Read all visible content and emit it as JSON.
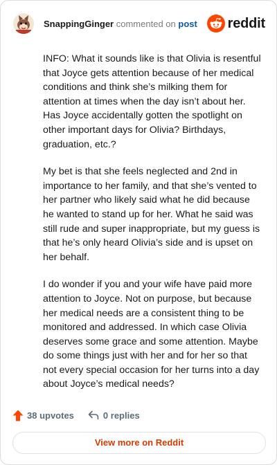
{
  "comment": {
    "author": "SnappingGinger",
    "verb": "commented on",
    "target": "post",
    "paragraphs": [
      "INFO: What it sounds like is that Olivia is resentful that Joyce gets attention because of her medical conditions and think she’s milking them for attention at times when the day isn’t about her. Has Joyce accidentally gotten the spotlight on other important days for Olivia? Birthdays, graduation, etc.?",
      "My bet is that she feels neglected and 2nd in importance to her family, and that she’s vented to her partner who likely said what he did because he wanted to stand up for her. What he said was still rude and super inappropriate, but my guess is that he’s only heard Olivia’s side and is upset on her behalf.",
      "I do wonder if you and your wife have paid more attention to Joyce. Not on purpose, but because her medical needs are a consistent thing to be monitored and addressed. In which case Olivia deserves some grace and some attention. Maybe do some things just with her and for her so that not every special occasion for her turns into a day about Joyce’s medical needs?"
    ]
  },
  "brand": {
    "wordmark": "reddit",
    "logo_icon": "reddit-snoo-icon",
    "color": "#ff4500"
  },
  "footer": {
    "upvotes": "38 upvotes",
    "replies": "0 replies",
    "upvote_icon": "upvote-arrow-icon",
    "reply_icon": "reply-arrow-icon",
    "upvote_color": "#ff4500"
  },
  "actions": {
    "view_more": "View more on Reddit"
  },
  "colors": {
    "link": "#0b5aa6",
    "accent": "#d93a00",
    "text": "#1a1a1b",
    "muted": "#5c6c74"
  }
}
